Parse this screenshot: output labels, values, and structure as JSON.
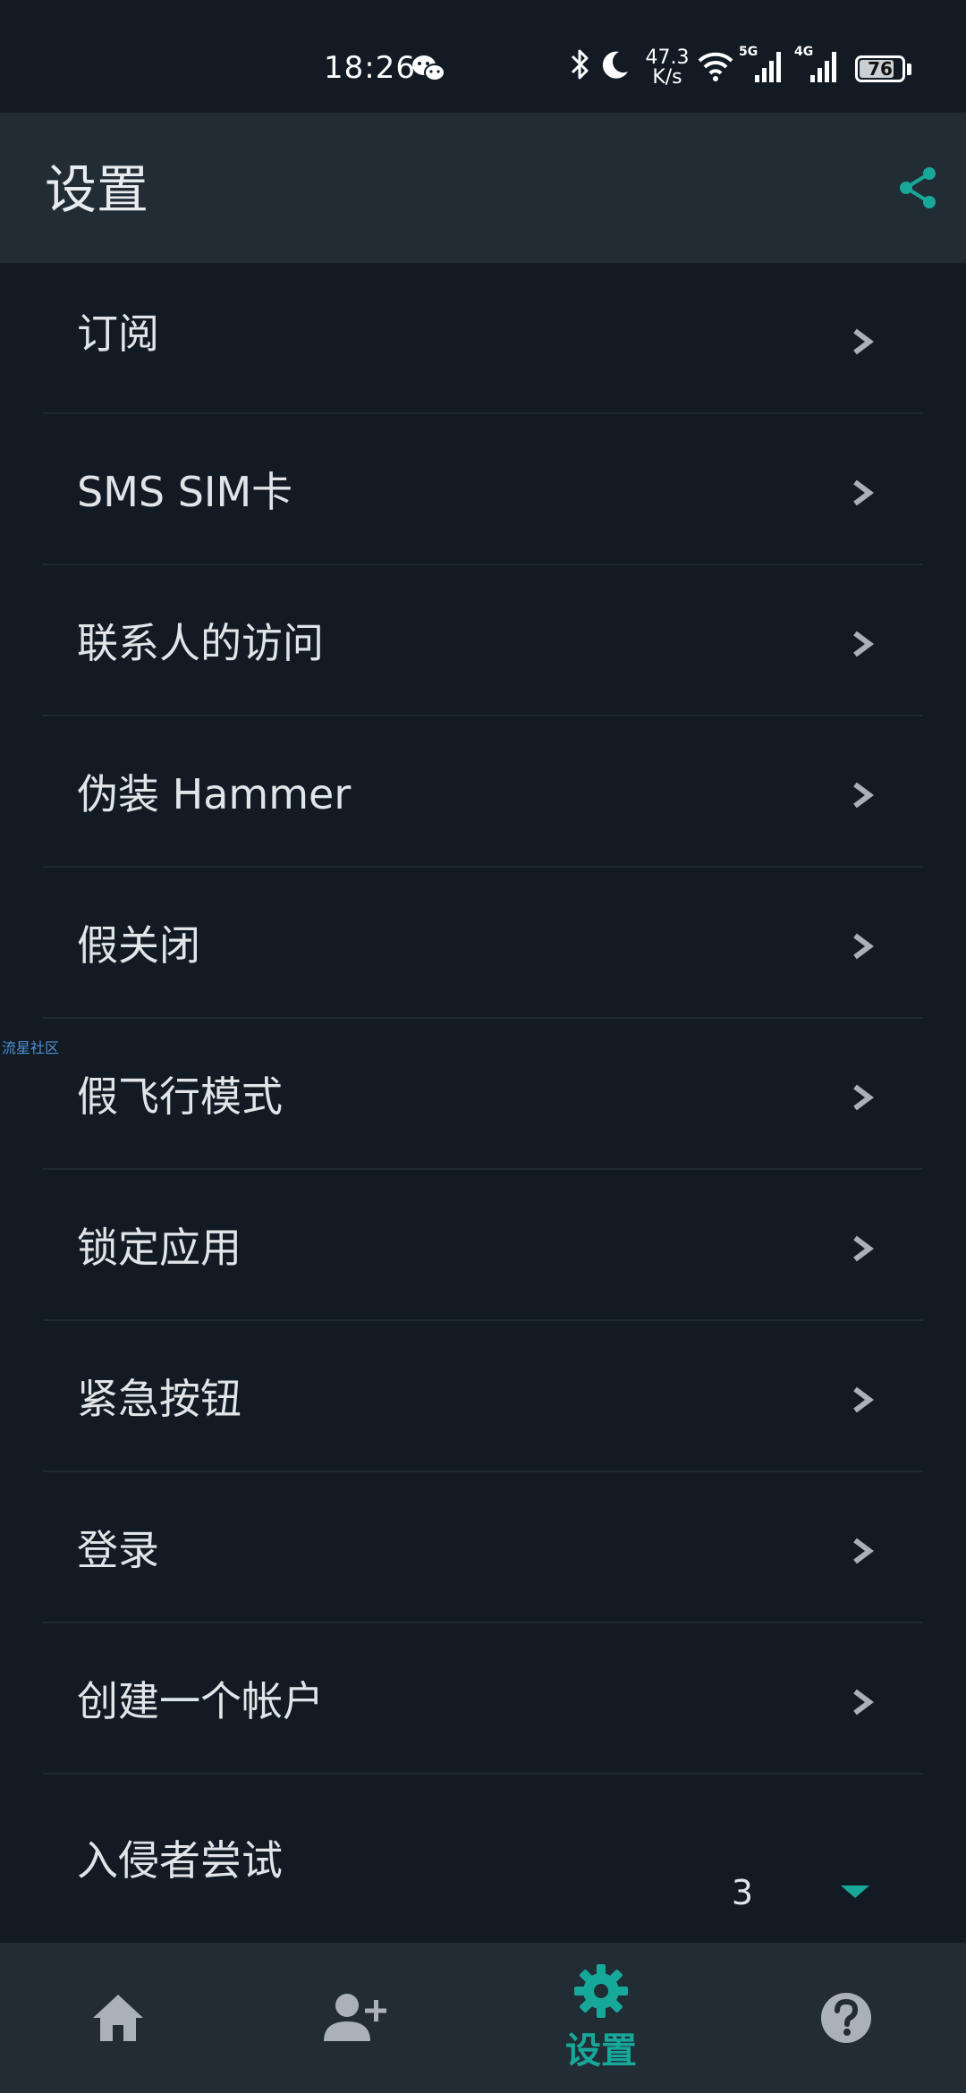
{
  "status_bar": {
    "time": "18:26",
    "net_speed_value": "47.3",
    "net_speed_unit": "K/s",
    "signal_1_label": "5G",
    "signal_2_label": "4G",
    "battery_level": "76"
  },
  "app_bar": {
    "title": "设置",
    "share_icon": "share-icon"
  },
  "list": {
    "items": [
      {
        "label": "订阅"
      },
      {
        "label": "SMS SIM卡"
      },
      {
        "label": "联系人的访问"
      },
      {
        "label": "伪装 Hammer"
      },
      {
        "label": "假关闭"
      },
      {
        "label": "假飞行模式"
      },
      {
        "label": "锁定应用"
      },
      {
        "label": "紧急按钮"
      },
      {
        "label": "登录"
      },
      {
        "label": "创建一个帐户"
      }
    ],
    "intruder": {
      "label": "入侵者尝试",
      "value": "3"
    }
  },
  "watermark": "流星社区",
  "bottom_nav": {
    "home_icon": "home-icon",
    "add_contact_icon": "add-person-icon",
    "settings_label": "设置",
    "help_icon": "help-icon"
  },
  "colors": {
    "background": "#121b23",
    "bar": "#222c35",
    "accent": "#17a899",
    "divider": "#1f2932",
    "icon_gray": "#aab1b8"
  }
}
